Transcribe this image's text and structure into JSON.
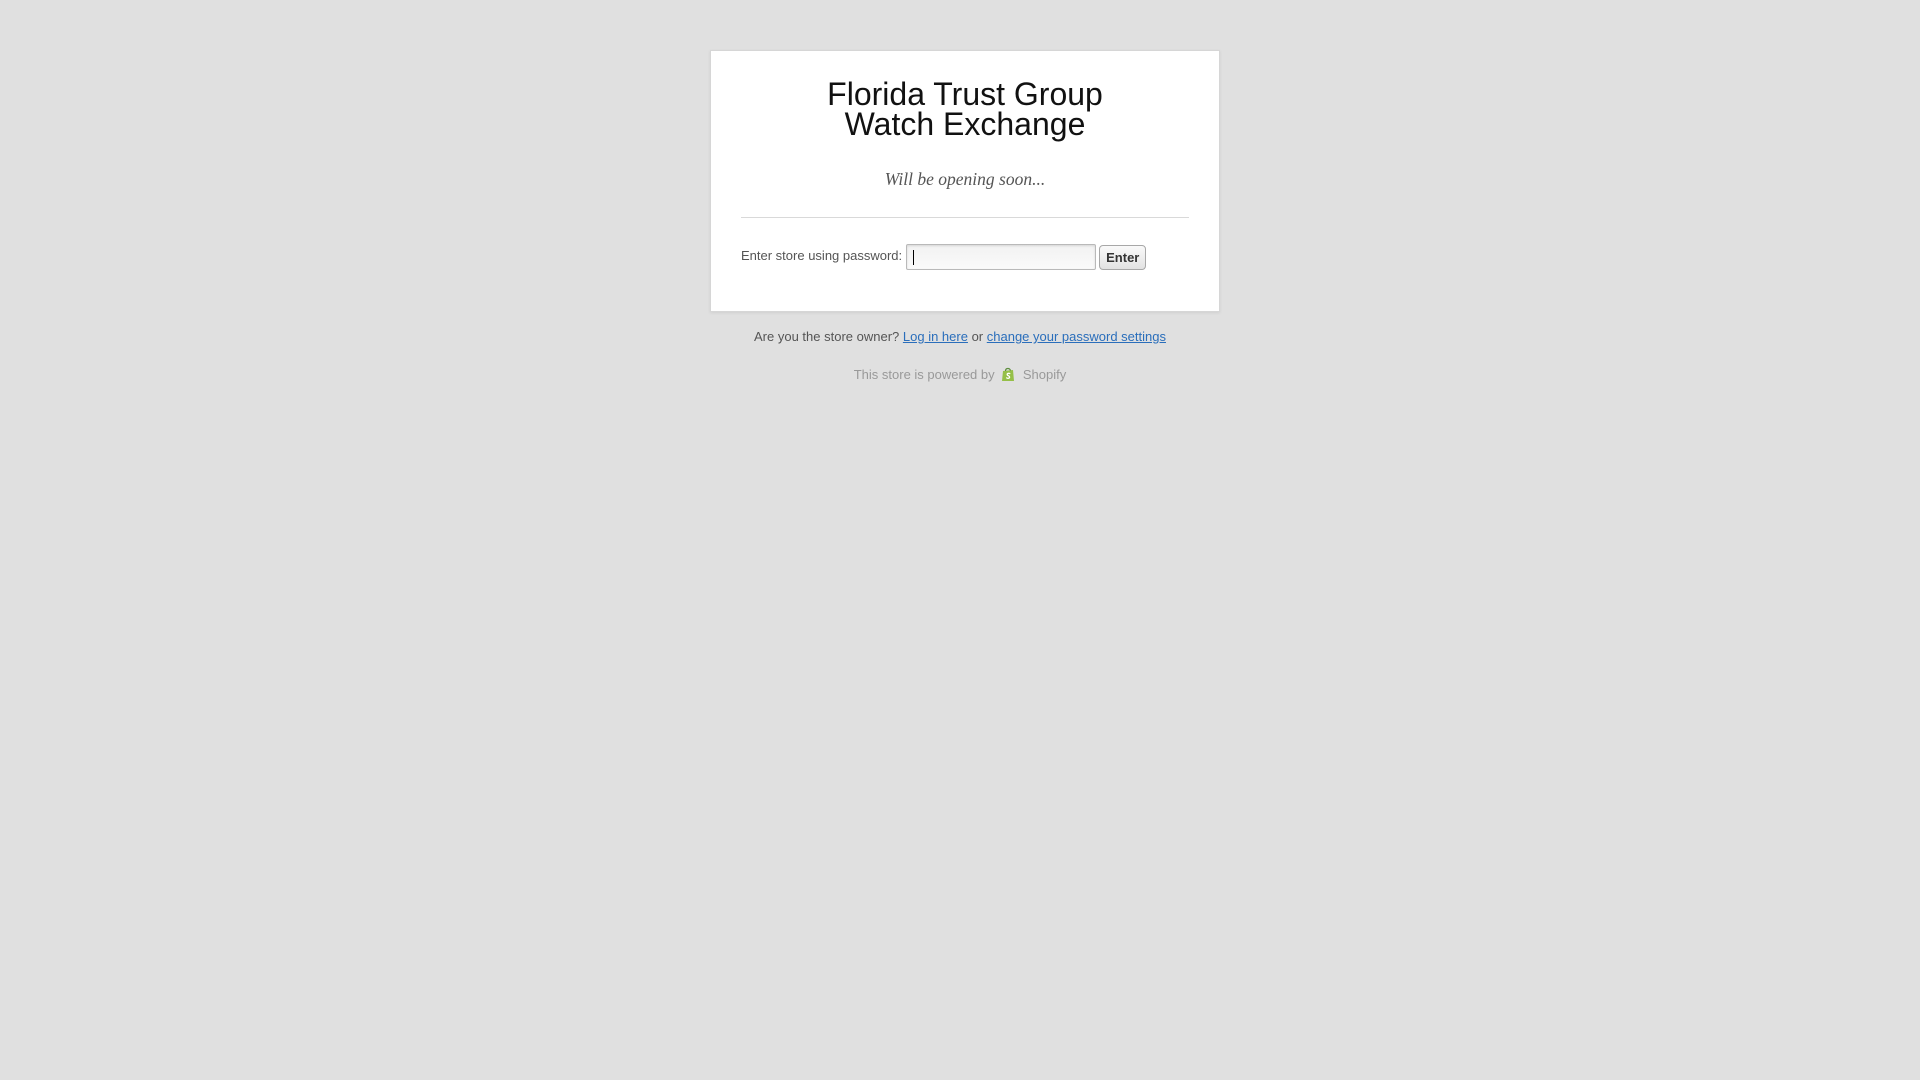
{
  "store": {
    "title": "Florida Trust Group Watch Exchange",
    "subtitle": "Will be opening soon..."
  },
  "password_form": {
    "label": "Enter store using password:",
    "input_value": "",
    "button_label": "Enter"
  },
  "owner_prompt": {
    "question": "Are you the store owner?",
    "login_link": "Log in here",
    "connector": "or",
    "settings_link": "change your password settings"
  },
  "powered_by": {
    "text": "This store is powered by",
    "brand": "Shopify",
    "icon": "shopify-bag-icon",
    "brand_color": "#95bf47"
  },
  "colors": {
    "background": "#e0e0e0",
    "card": "#ffffff",
    "link": "#2a6ebb"
  }
}
